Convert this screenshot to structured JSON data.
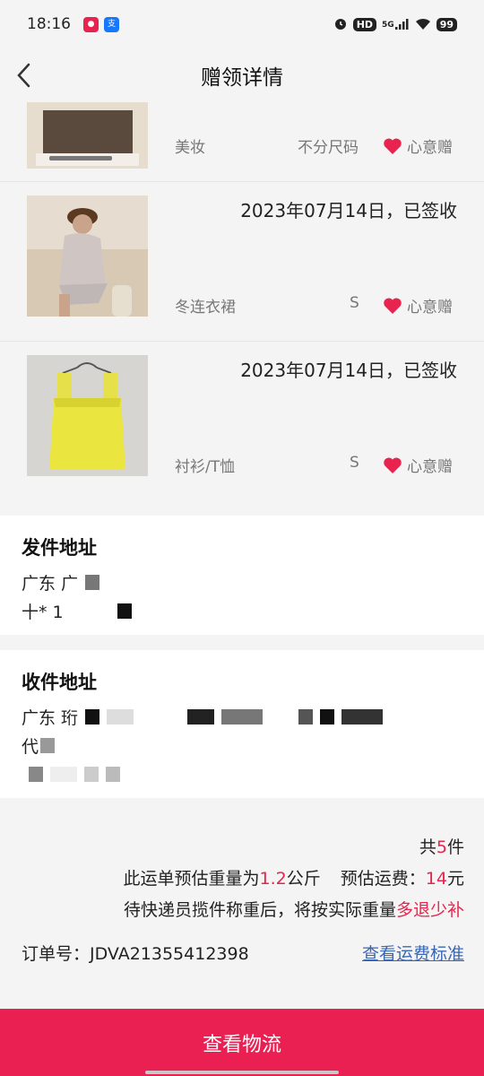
{
  "status_bar": {
    "time": "18:16",
    "hd_label": "HD",
    "network_label": "5G",
    "battery": "99"
  },
  "header": {
    "title": "赠领详情"
  },
  "items": [
    {
      "date": "",
      "category": "美妆",
      "size": "不分尺码",
      "gift_label": "心意赠"
    },
    {
      "date": "2023年07月14日，已签收",
      "category": "冬连衣裙",
      "size": "S",
      "gift_label": "心意赠"
    },
    {
      "date": "2023年07月14日，已签收",
      "category": "衬衫/T恤",
      "size": "S",
      "gift_label": "心意赠"
    }
  ],
  "sender": {
    "title": "发件地址",
    "line1": "广东 广",
    "line2": "十* 1"
  },
  "receiver": {
    "title": "收件地址",
    "line1": "广东 珩",
    "line2": "代"
  },
  "summary": {
    "count_prefix": "共",
    "count": "5",
    "count_suffix": "件",
    "weight_prefix": "此运单预估重量为",
    "weight": "1.2",
    "weight_unit": "公斤",
    "fee_prefix": "预估运费：",
    "fee": "14",
    "fee_unit": "元",
    "note_prefix": "待快递员揽件称重后，将按实际重量",
    "note_highlight": "多退少补",
    "order_label": "订单号：",
    "order_no": "JDVA21355412398",
    "standard_link": "查看运费标准"
  },
  "bottom_button": {
    "label": "查看物流"
  },
  "colors": {
    "accent": "#ea1f52",
    "highlight": "#e8244e",
    "link": "#3b67b2",
    "heart": "#e8244e"
  }
}
